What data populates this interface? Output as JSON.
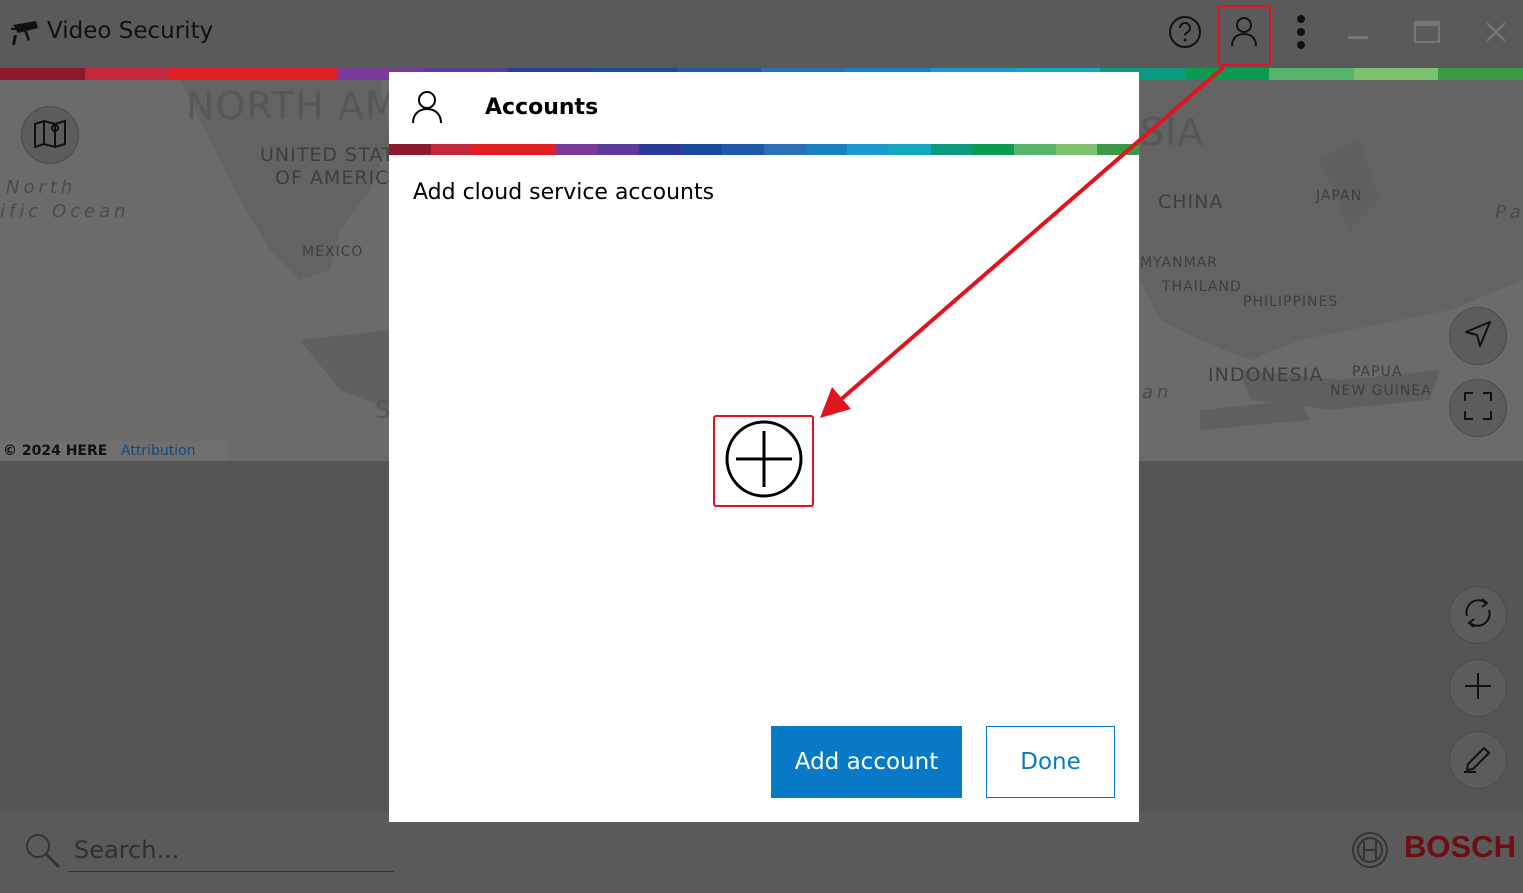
{
  "window": {
    "title": "Video Security",
    "app_icon": "security-camera-icon"
  },
  "titlebar_buttons": [
    {
      "name": "help-icon"
    },
    {
      "name": "user-account-icon"
    },
    {
      "name": "more-vertical-icon"
    },
    {
      "name": "minimize-icon"
    },
    {
      "name": "maximize-icon"
    },
    {
      "name": "close-icon"
    }
  ],
  "map": {
    "labels": {
      "north_america": "NORTH AM",
      "united_states": "UNITED STATES",
      "of_america": "OF AMERICA",
      "north": "North",
      "pacific_ocean": "ific Ocean",
      "mexico": "MEXICO",
      "asia": "SIA",
      "china": "CHINA",
      "japan": "JAPAN",
      "pa": "Pa",
      "myanmar": "MYANMAR",
      "thailand": "THAILAND",
      "philippines": "PHILIPPINES",
      "indonesia": "INDONESIA",
      "papua": "PAPUA",
      "new_guinea": "NEW GUINEA",
      "an": "an",
      "s": "S"
    },
    "copyright": "© 2024 HERE",
    "attribution_link": "Attribution"
  },
  "side_buttons": [
    "map-layers-icon",
    "locate-icon",
    "fullscreen-icon",
    "refresh-icon",
    "add-icon",
    "edit-icon"
  ],
  "search": {
    "placeholder": "Search..."
  },
  "brand": {
    "name": "BOSCH",
    "color": "#6e0e14"
  },
  "dialog": {
    "title": "Accounts",
    "subtitle": "Add cloud service accounts",
    "add_account_label": "Add account",
    "done_label": "Done",
    "accent": "#0879c6"
  },
  "strip_colors": [
    "#8c1a2a",
    "#c4283c",
    "#e21f26",
    "#e21f26",
    "#7a3a9a",
    "#5b3a9c",
    "#2b3b9a",
    "#1a4a9c",
    "#1f5aa8",
    "#2a6fb8",
    "#1b7fc4",
    "#1a9ad0",
    "#13a7c2",
    "#0a9a80",
    "#0c9a50",
    "#58b46a",
    "#7cc070",
    "#3a9a48"
  ],
  "annotation_color": "#e0141e"
}
